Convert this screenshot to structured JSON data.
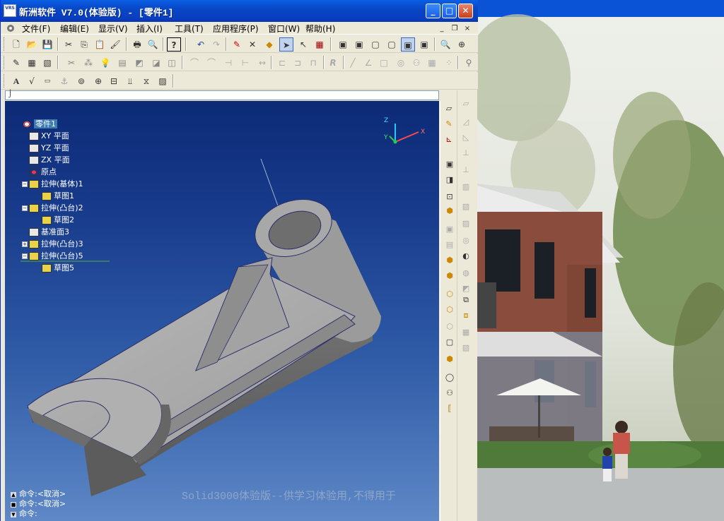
{
  "window": {
    "title": "新洲软件 V7.0(体验版) - [零件1]",
    "icon_text": "VRS",
    "minimize": "_",
    "maximize": "□",
    "close": "✕"
  },
  "menu": [
    "文件(F)",
    "编辑(E)",
    "显示(V)",
    "插入(I)",
    "工具(T)",
    "应用程序(P)",
    "窗口(W)",
    "帮助(H)"
  ],
  "mdi": {
    "minimize": "_",
    "restore": "❐",
    "close": "×"
  },
  "toolbar1": [
    "new-icon",
    "open-icon",
    "save-icon",
    "cut-icon",
    "copy-icon",
    "paste-icon",
    "format-paint-icon",
    "print-icon",
    "print-preview-icon",
    "help-icon",
    "undo-icon",
    "redo-icon",
    "edit-icon",
    "delete-icon",
    "color-icon",
    "select-icon",
    "select-filter-icon",
    "calculator-icon",
    "view-a-icon",
    "view-b-icon",
    "view-c-icon",
    "view-d-icon",
    "view-e-icon",
    "zoom-icon",
    "zoom-in-icon"
  ],
  "toolbar2": [
    "sketch-icon",
    "grid-icon",
    "image-icon",
    "measure-icon",
    "pattern-icon",
    "light-icon",
    "fill-icon",
    "render-icon",
    "texture-icon"
  ],
  "toolbar3": [
    "text-icon",
    "dimension-icon",
    "label-icon",
    "anchor-icon",
    "target-icon",
    "center-icon",
    "plate-icon",
    "beam-icon",
    "spring-icon",
    "hatch-icon"
  ],
  "ruler": "⌡",
  "tree": {
    "root": "零件1",
    "items": [
      {
        "label": "XY 平面",
        "kind": "plane"
      },
      {
        "label": "YZ 平面",
        "kind": "plane"
      },
      {
        "label": "ZX 平面",
        "kind": "plane"
      },
      {
        "label": "原点",
        "kind": "origin"
      },
      {
        "label": "拉伸(基体)1",
        "kind": "extrude",
        "expand": "−"
      },
      {
        "label": "草图1",
        "kind": "sketch"
      },
      {
        "label": "拉伸(凸台)2",
        "kind": "extrude",
        "expand": "−"
      },
      {
        "label": "草图2",
        "kind": "sketch"
      },
      {
        "label": "基准面3",
        "kind": "plane"
      },
      {
        "label": "拉伸(凸台)3",
        "kind": "extrude",
        "expand": "+"
      },
      {
        "label": "拉伸(凸台)5",
        "kind": "extrude",
        "expand": "−"
      },
      {
        "label": "草图5",
        "kind": "sketch"
      }
    ]
  },
  "axes": {
    "x": "X",
    "y": "Y",
    "z": "Z"
  },
  "watermark": "Solid3000体验版--供学习体验用,不得用于",
  "command_lines": [
    "命令:<取消>",
    "命令:<取消>",
    "命令:"
  ],
  "colors": {
    "titlebar": "#0a4fd6",
    "viewport_top": "#0c2a76",
    "viewport_bottom": "#5e88c6",
    "part": "#a9a9a9"
  }
}
